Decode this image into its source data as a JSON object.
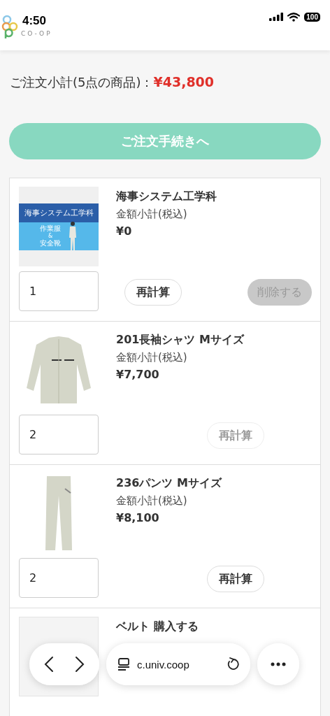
{
  "status_bar": {
    "time": "4:50",
    "battery": "100"
  },
  "header": {
    "logo_text": "CO-OP"
  },
  "summary": {
    "label": "ご注文小計(5点の商品)：",
    "total": "¥43,800"
  },
  "checkout_button": {
    "label": "ご注文手続きへ"
  },
  "items": [
    {
      "kind": "banner",
      "banner_title": "海事システム工学科",
      "banner_lines": [
        "作業服",
        "&",
        "安全靴"
      ],
      "name": "海事システム工学科",
      "subtotal_label": "金額小計(税込)",
      "price": "¥0",
      "quantity": "1",
      "recalc": {
        "label": "再計算",
        "disabled": false
      },
      "delete": {
        "label": "削除する",
        "disabled": true
      }
    },
    {
      "kind": "shirt",
      "name": "201長袖シャツ Mサイズ",
      "subtotal_label": "金額小計(税込)",
      "price": "¥7,700",
      "quantity": "2",
      "recalc": {
        "label": "再計算",
        "disabled": true
      }
    },
    {
      "kind": "pants",
      "name": "236パンツ Mサイズ",
      "subtotal_label": "金額小計(税込)",
      "price": "¥8,100",
      "quantity": "2",
      "recalc": {
        "label": "再計算",
        "disabled": false
      }
    },
    {
      "kind": "blank",
      "name": "ベルト 購入する"
    }
  ],
  "browser_bar": {
    "url": "c.univ.coop"
  }
}
